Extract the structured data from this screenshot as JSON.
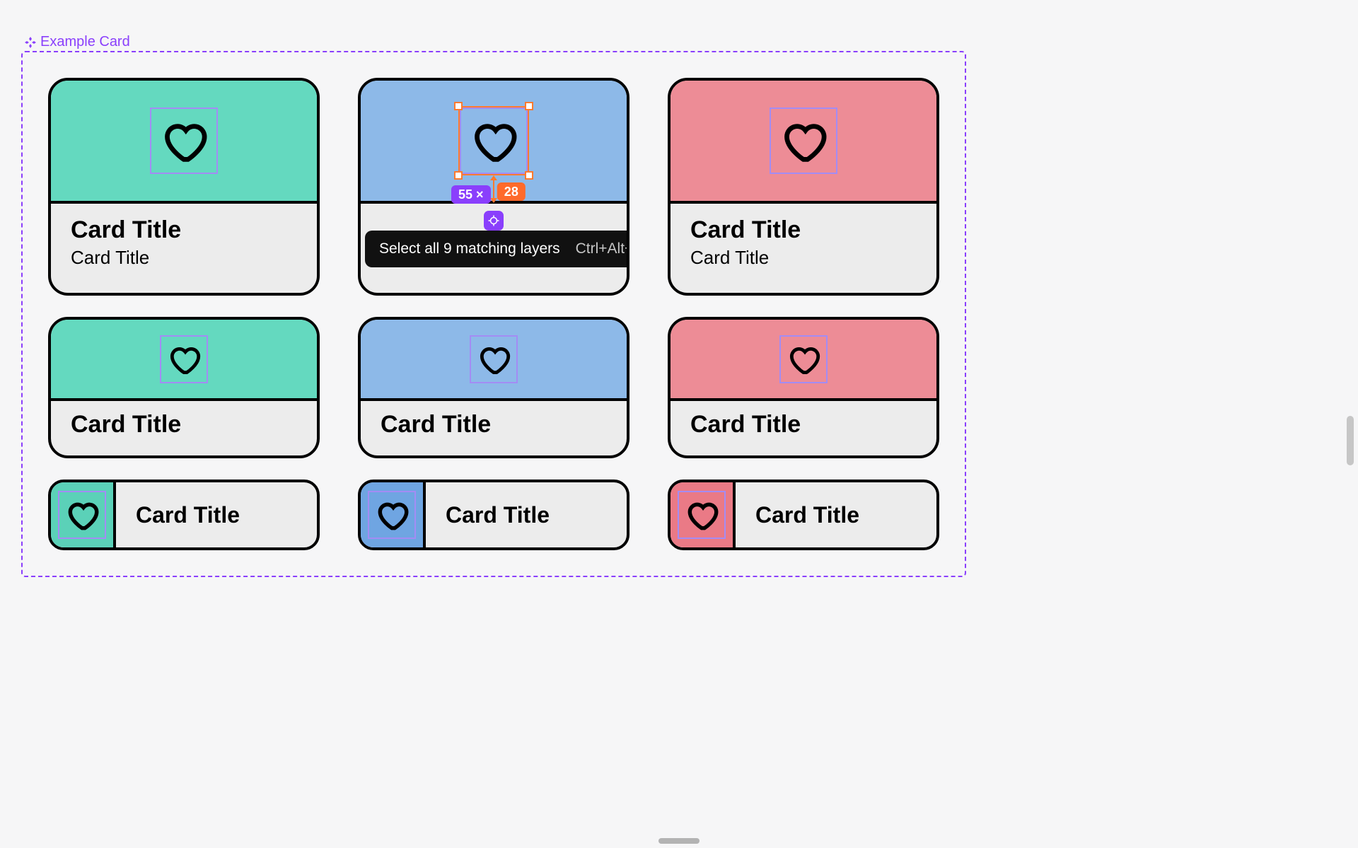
{
  "frame": {
    "label": "Example Card"
  },
  "colors": {
    "purple": "#8a3ffc",
    "orange": "#ff6a2b",
    "teal": "#64d9bf",
    "blue": "#8db9e8",
    "pink": "#ed8c96"
  },
  "cards": {
    "title": "Card Title",
    "subtitle": "Card Title"
  },
  "selection": {
    "distance": "55",
    "multiplier_label": "×",
    "size": "28"
  },
  "tooltip": {
    "text": "Select all 9 matching layers",
    "shortcut": "Ctrl+Alt+A"
  }
}
